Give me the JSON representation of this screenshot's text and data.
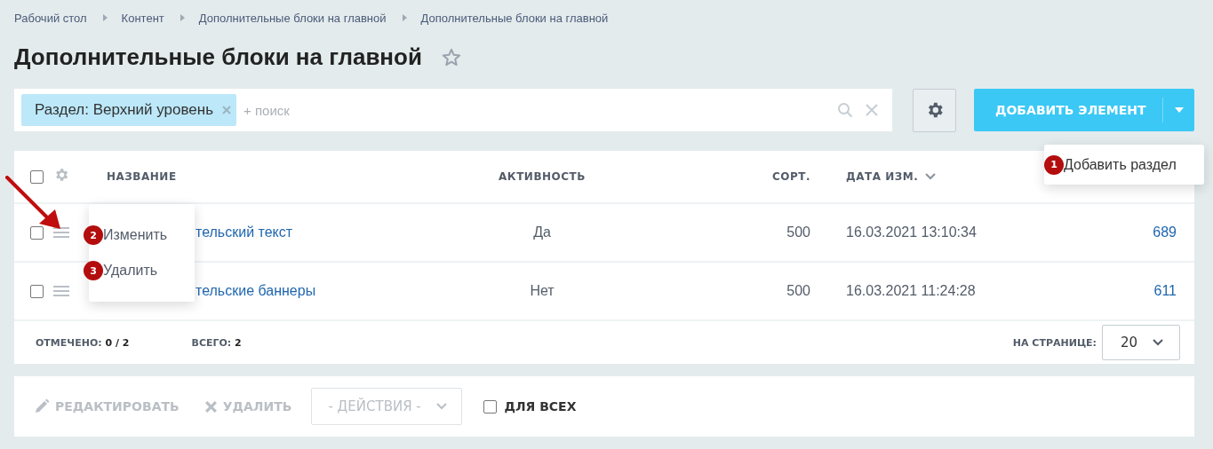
{
  "breadcrumbs": [
    {
      "label": "Рабочий стол"
    },
    {
      "label": "Контент"
    },
    {
      "label": "Дополнительные блоки на главной"
    },
    {
      "label": "Дополнительные блоки на главной"
    }
  ],
  "title": "Дополнительные блоки на главной",
  "filter": {
    "chip": "Раздел: Верхний уровень",
    "placeholder": "+ поиск"
  },
  "add_button": {
    "label": "ДОБАВИТЬ ЭЛЕМЕНТ"
  },
  "add_menu": [
    {
      "badge": "1",
      "label": "Добавить раздел"
    }
  ],
  "table": {
    "header_checked": false,
    "columns": [
      {
        "label": "НАЗВАНИЕ",
        "sorted": false
      },
      {
        "label": "АКТИВНОСТЬ",
        "sorted": false
      },
      {
        "label": "СОРТ.",
        "sorted": false
      },
      {
        "label": "ДАТА ИЗМ.",
        "sorted": true
      }
    ],
    "rows": [
      {
        "checked": false,
        "name": "тельский текст",
        "active": "Да",
        "sort": "500",
        "date": "16.03.2021 13:10:34",
        "id": "689"
      },
      {
        "checked": false,
        "name": "тельские баннеры",
        "active": "Нет",
        "sort": "500",
        "date": "16.03.2021 11:24:28",
        "id": "611"
      }
    ]
  },
  "row_menu": [
    {
      "badge": "2",
      "label": "Изменить"
    },
    {
      "badge": "3",
      "label": "Удалить"
    }
  ],
  "footer": {
    "checked_label": "ОТМЕЧЕНО:",
    "checked_value": "0 / 2",
    "total_label": "ВСЕГО:",
    "total_value": "2",
    "per_page_label": "НА СТРАНИЦЕ:",
    "per_page": "20"
  },
  "actions": {
    "edit": {
      "label": "РЕДАКТИРОВАТЬ",
      "disabled": true
    },
    "delete": {
      "label": "УДАЛИТЬ",
      "disabled": true
    },
    "select": "- ДЕЙСТВИЯ -",
    "for_all": {
      "label": "ДЛЯ ВСЕХ",
      "checked": false
    }
  }
}
